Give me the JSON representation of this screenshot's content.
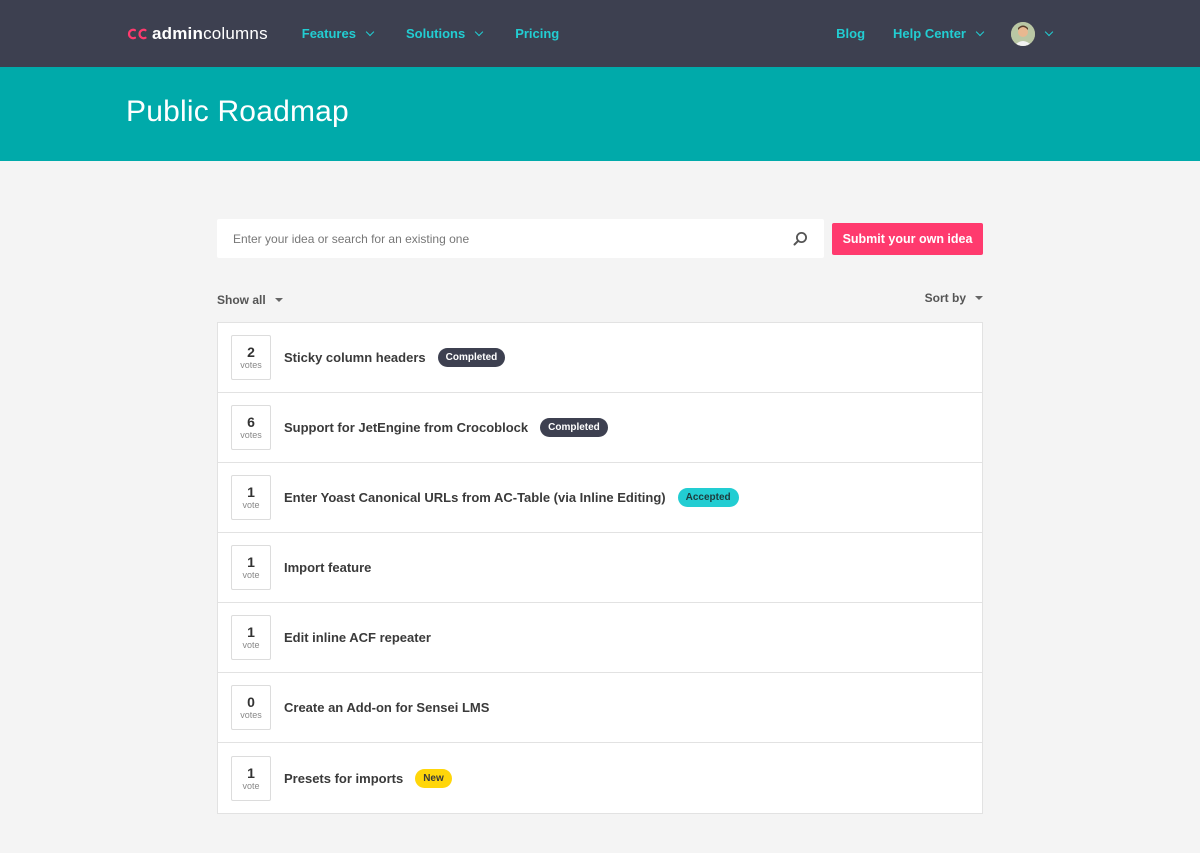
{
  "header": {
    "logo": {
      "part1": "admin",
      "part2": "columns",
      "icon": "admincolumns-logo-icon"
    },
    "nav": [
      {
        "label": "Features",
        "dropdown": true
      },
      {
        "label": "Solutions",
        "dropdown": true
      },
      {
        "label": "Pricing",
        "dropdown": false
      }
    ],
    "nav_right": [
      {
        "label": "Blog",
        "dropdown": false
      },
      {
        "label": "Help Center",
        "dropdown": true
      }
    ],
    "avatar_icon": "user-avatar"
  },
  "hero": {
    "title": "Public Roadmap"
  },
  "search": {
    "placeholder": "Enter your idea or search for an existing one",
    "value": "",
    "submit_label": "Submit your own idea"
  },
  "filters": {
    "show_label": "Show all",
    "sort_label": "Sort by"
  },
  "colors": {
    "topbar": "#3d4050",
    "hero": "#00aaaa",
    "accent": "#22cdd2",
    "submit": "#ff3a6e",
    "new_badge": "#ffd60a"
  },
  "ideas": [
    {
      "votes": "2",
      "vote_label": "votes",
      "title": "Sticky column headers",
      "status": "Completed",
      "status_type": "completed"
    },
    {
      "votes": "6",
      "vote_label": "votes",
      "title": "Support for JetEngine from Crocoblock",
      "status": "Completed",
      "status_type": "completed"
    },
    {
      "votes": "1",
      "vote_label": "vote",
      "title": "Enter Yoast Canonical URLs from AC-Table (via Inline Editing)",
      "status": "Accepted",
      "status_type": "accepted"
    },
    {
      "votes": "1",
      "vote_label": "vote",
      "title": "Import feature",
      "status": "",
      "status_type": ""
    },
    {
      "votes": "1",
      "vote_label": "vote",
      "title": "Edit inline ACF repeater",
      "status": "",
      "status_type": ""
    },
    {
      "votes": "0",
      "vote_label": "votes",
      "title": "Create an Add-on for Sensei LMS",
      "status": "",
      "status_type": ""
    },
    {
      "votes": "1",
      "vote_label": "vote",
      "title": "Presets for imports",
      "status": "New",
      "status_type": "new"
    }
  ]
}
